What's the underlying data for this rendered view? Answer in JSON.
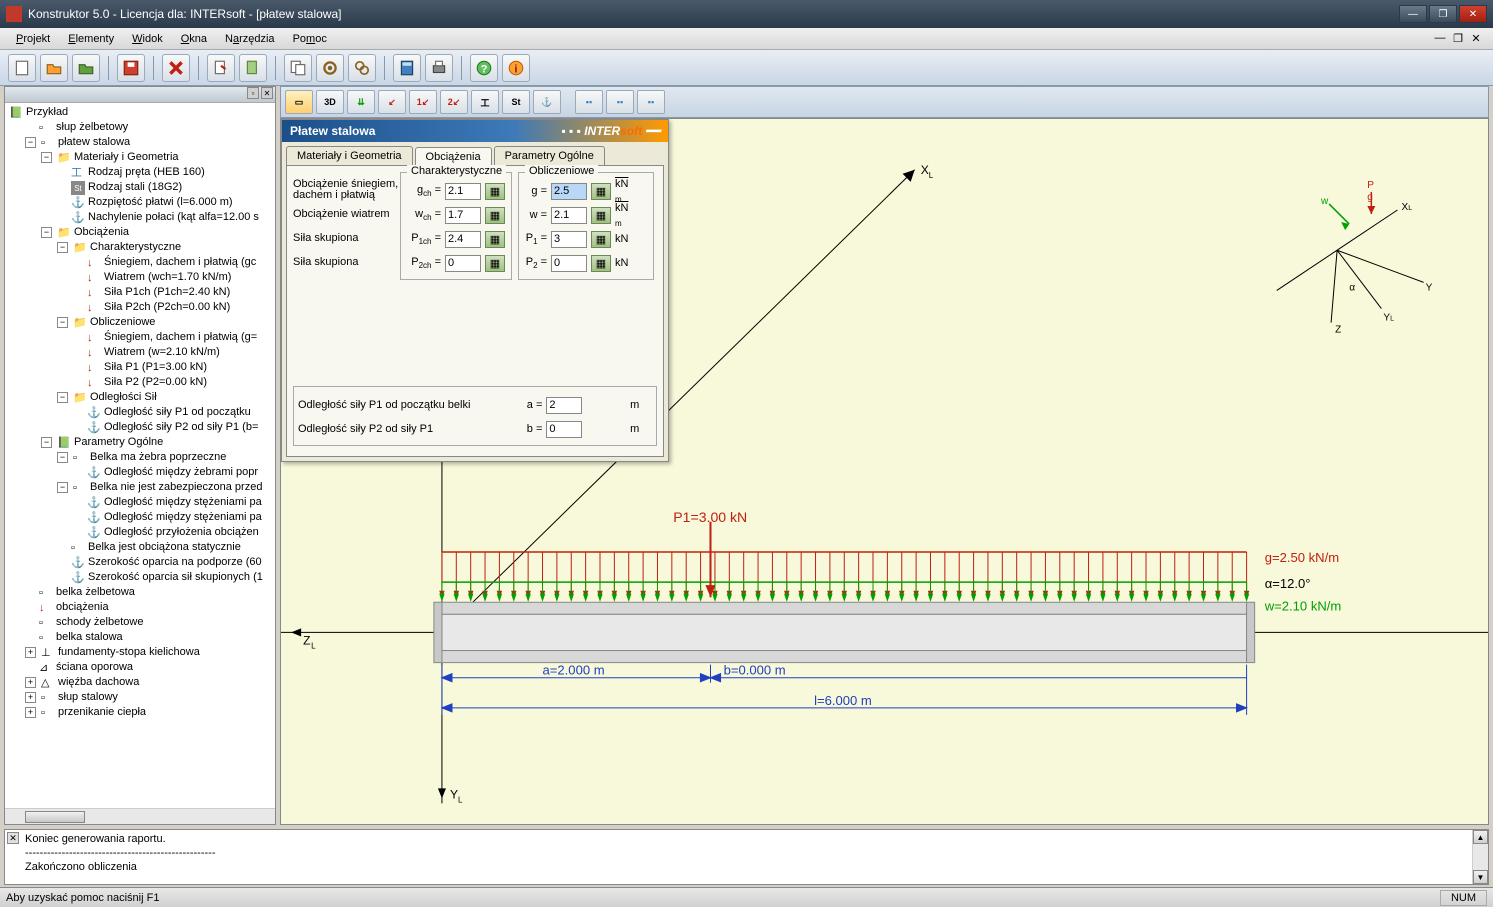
{
  "window": {
    "title": "Konstruktor 5.0 - Licencja dla: INTERsoft - [płatew stalowa]",
    "status": "Aby uzyskać pomoc naciśnij F1",
    "statusNum": "NUM"
  },
  "menu": {
    "projekt": "Projekt",
    "elementy": "Elementy",
    "widok": "Widok",
    "okna": "Okna",
    "narzedzia": "Narzędzia",
    "pomoc": "Pomoc"
  },
  "tree": {
    "root": "Przykład",
    "n1": "słup żelbetowy",
    "n2": "płatew stalowa",
    "n2a": "Materiały i Geometria",
    "n2a1": "Rodzaj pręta (HEB 160)",
    "n2a2": "Rodzaj stali (18G2)",
    "n2a3": "Rozpiętość płatwi (l=6.000 m)",
    "n2a4": "Nachylenie połaci (kąt alfa=12.00 s",
    "n2b": "Obciążenia",
    "n2b1": "Charakterystyczne",
    "n2b1a": "Śniegiem, dachem i płatwią (gc",
    "n2b1b": "Wiatrem (wch=1.70 kN/m)",
    "n2b1c": "Siła P1ch (P1ch=2.40 kN)",
    "n2b1d": "Siła P2ch (P2ch=0.00 kN)",
    "n2b2": "Obliczeniowe",
    "n2b2a": "Śniegiem, dachem i płatwią (g=",
    "n2b2b": "Wiatrem (w=2.10 kN/m)",
    "n2b2c": "Siła P1 (P1=3.00 kN)",
    "n2b2d": "Siła P2 (P2=0.00 kN)",
    "n2b3": "Odległości Sił",
    "n2b3a": "Odległość siły P1 od początku",
    "n2b3b": "Odległość siły P2 od siły P1 (b=",
    "n2c": "Parametry Ogólne",
    "n2c1": "Belka ma żebra poprzeczne",
    "n2c1a": "Odległość między żebrami popr",
    "n2c2": "Belka nie jest zabezpieczona przed",
    "n2c2a": "Odległość między stężeniami pa",
    "n2c2b": "Odległość między stężeniami pa",
    "n2c2c": "Odległość przyłożenia obciążen",
    "n2c3": "Belka jest obciążona statycznie",
    "n2c4": "Szerokość oparcia na podporze (60",
    "n2c5": "Szerokość oparcia sił skupionych (1",
    "n3": "belka żelbetowa",
    "n4": "obciążenia",
    "n5": "schody żelbetowe",
    "n6": "belka stalowa",
    "n7": "fundamenty-stopa kielichowa",
    "n8": "ściana oporowa",
    "n9": "więźba dachowa",
    "n10": "słup stalowy",
    "n11": "przenikanie ciepła"
  },
  "dialog": {
    "title": "Płatew stalowa",
    "brand": "INTERsoft",
    "tab1": "Materiały i Geometria",
    "tab2": "Obciążenia",
    "tab3": "Parametry Ogólne",
    "fsChar": "Charakterystyczne",
    "fsObl": "Obliczeniowe",
    "r1": "Obciążenie śniegiem, dachem i płatwią",
    "r2": "Obciążenie wiatrem",
    "r3": "Siła skupiona",
    "r4": "Siła skupiona",
    "r5": "Odległość siły P1 od początku belki",
    "r6": "Odległość siły P2 od siły P1",
    "gch": "2.1",
    "wch": "1.7",
    "p1ch": "2.4",
    "p2ch": "0",
    "g": "2.5",
    "w": "2.1",
    "p1": "3",
    "p2": "0",
    "a": "2",
    "b": "0",
    "kNm": "kN/m",
    "kN": "kN",
    "m": "m"
  },
  "beam": {
    "p1": "P1=3.00 kN",
    "g": "g=2.50 kN/m",
    "alpha": "α=12.0°",
    "wload": "w=2.10 kN/m",
    "a": "a=2.000 m",
    "b": "b=0.000 m",
    "l": "l=6.000 m",
    "xL": "X",
    "yL": "Y",
    "zL": "Z"
  },
  "axes3d": {
    "w": "w",
    "p": "P",
    "g": "g",
    "x": "X",
    "y": "Y",
    "z": "Z",
    "a": "α"
  },
  "output": {
    "l1": "Koniec generowania raportu.",
    "l2": "----------------------------------------------------",
    "l3": "Zakończono obliczenia"
  }
}
